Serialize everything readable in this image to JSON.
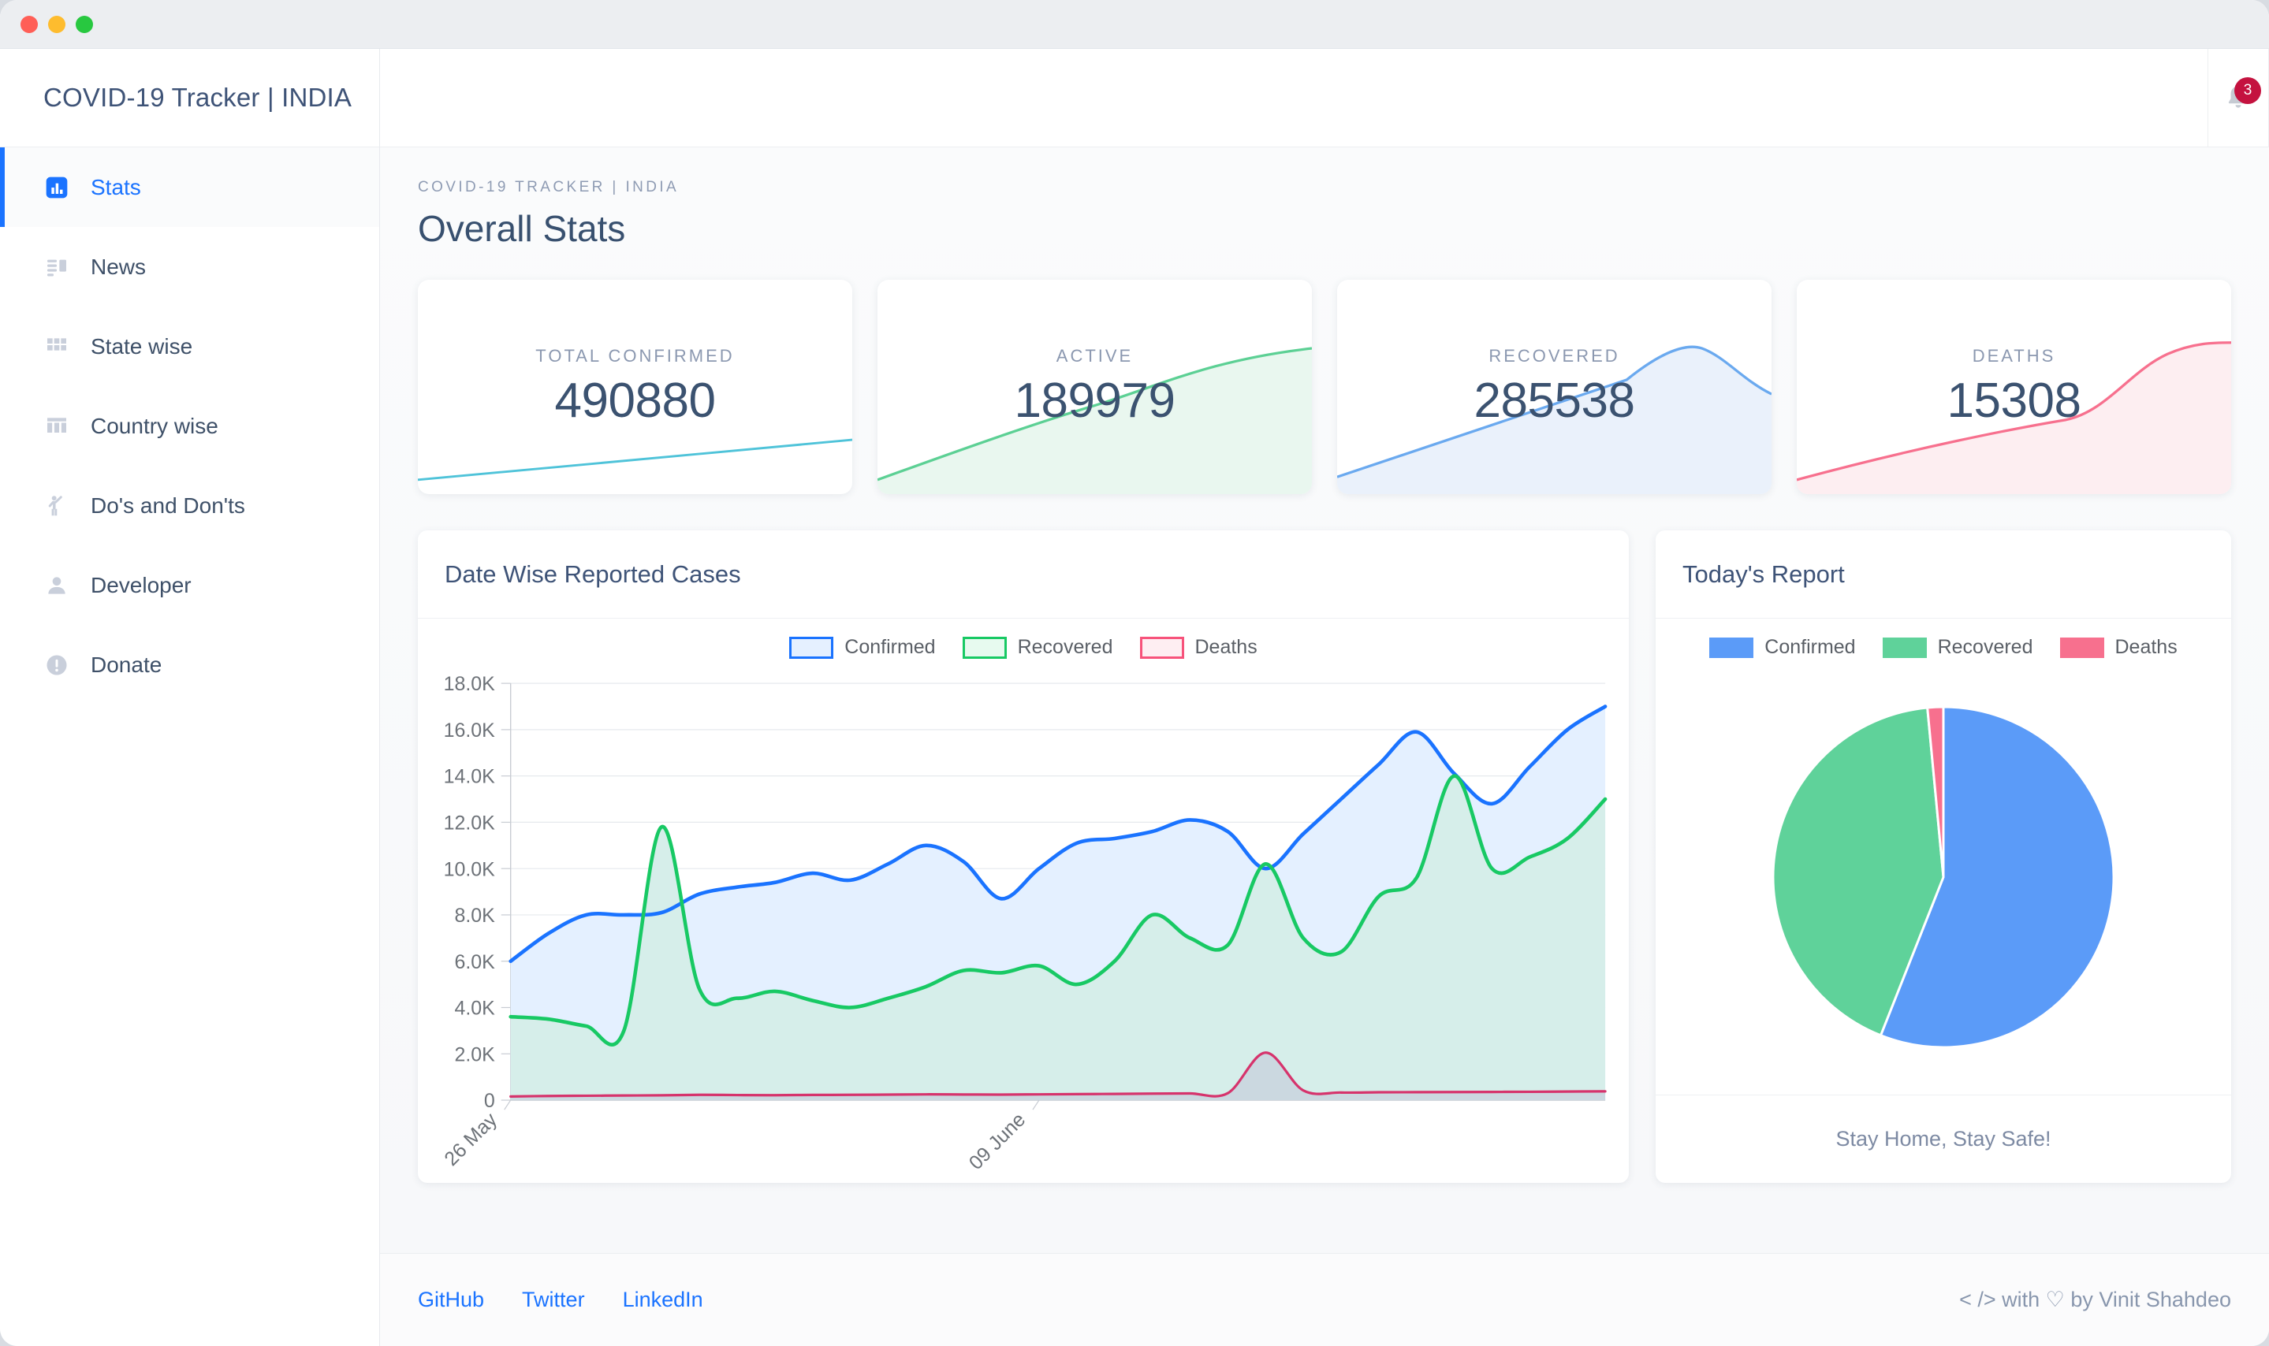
{
  "window": {
    "traffic_lights": [
      "close",
      "minimize",
      "zoom"
    ]
  },
  "sidebar": {
    "brand": "COVID-19 Tracker | INDIA",
    "items": [
      {
        "label": "Stats",
        "icon": "bar-chart-icon",
        "active": true
      },
      {
        "label": "News",
        "icon": "news-list-icon",
        "active": false
      },
      {
        "label": "State wise",
        "icon": "grid-icon",
        "active": false
      },
      {
        "label": "Country wise",
        "icon": "table-columns-icon",
        "active": false
      },
      {
        "label": "Do's and Don'ts",
        "icon": "person-wave-icon",
        "active": false
      },
      {
        "label": "Developer",
        "icon": "user-icon",
        "active": false
      },
      {
        "label": "Donate",
        "icon": "info-circle-icon",
        "active": false
      }
    ]
  },
  "topbar": {
    "bell_icon": "bell-icon",
    "notification_count": "3"
  },
  "header": {
    "eyebrow": "COVID-19 TRACKER | INDIA",
    "title": "Overall Stats"
  },
  "stat_cards": [
    {
      "label": "TOTAL CONFIRMED",
      "value": "490880",
      "color": "#4fc3d9"
    },
    {
      "label": "ACTIVE",
      "value": "189979",
      "color": "#5cd094"
    },
    {
      "label": "RECOVERED",
      "value": "285538",
      "color": "#6aa9ef"
    },
    {
      "label": "DEATHS",
      "value": "15308",
      "color": "#f7708e"
    }
  ],
  "line_panel": {
    "title": "Date Wise Reported Cases"
  },
  "pie_panel": {
    "title": "Today's Report",
    "footer_note": "Stay Home, Stay Safe!"
  },
  "footer": {
    "links": [
      "GitHub",
      "Twitter",
      "LinkedIn"
    ],
    "credit": "< /> with ♡ by Vinit Shahdeo"
  },
  "chart_data": [
    {
      "id": "date-wise-reported-cases",
      "type": "area",
      "title": "Date Wise Reported Cases",
      "xlabel": "",
      "ylabel": "",
      "ylim": [
        0,
        18000
      ],
      "ytick_labels": [
        "0",
        "2.0K",
        "4.0K",
        "6.0K",
        "8.0K",
        "10.0K",
        "12.0K",
        "14.0K",
        "16.0K",
        "18.0K"
      ],
      "yticks": [
        0,
        2000,
        4000,
        6000,
        8000,
        10000,
        12000,
        14000,
        16000,
        18000
      ],
      "grid": true,
      "legend_position": "top-center",
      "xtick_labels": [
        "26 May",
        "09 June"
      ],
      "xtick_indices": [
        0,
        14
      ],
      "x": [
        "26 May",
        "27 May",
        "28 May",
        "29 May",
        "30 May",
        "31 May",
        "01 June",
        "02 June",
        "03 June",
        "04 June",
        "05 June",
        "06 June",
        "07 June",
        "08 June",
        "09 June",
        "10 June",
        "11 June",
        "12 June",
        "13 June",
        "14 June",
        "15 June",
        "16 June",
        "17 June",
        "18 June",
        "19 June",
        "20 June",
        "21 June",
        "22 June",
        "23 June",
        "24 June"
      ],
      "series": [
        {
          "name": "Confirmed",
          "color": "#1a73ff",
          "fill": "#e4f0ff",
          "values": [
            6000,
            7200,
            8000,
            8000,
            8100,
            8900,
            9200,
            9400,
            9800,
            9500,
            10200,
            11000,
            10300,
            8700,
            10000,
            11100,
            11300,
            11600,
            12100,
            11600,
            10000,
            11500,
            13000,
            14500,
            15900,
            14100,
            12800,
            14400,
            16000,
            17000
          ]
        },
        {
          "name": "Recovered",
          "color": "#18c964",
          "fill": "#d6eeea",
          "values": [
            3600,
            3500,
            3200,
            3000,
            11800,
            4800,
            4400,
            4700,
            4300,
            4000,
            4400,
            4900,
            5600,
            5500,
            5800,
            5000,
            6000,
            8000,
            7000,
            6700,
            10200,
            7000,
            6400,
            8800,
            9600,
            14000,
            10000,
            10500,
            11300,
            13000
          ]
        },
        {
          "name": "Deaths",
          "color": "#d6336c",
          "fill": "#c9d4de",
          "values": [
            160,
            180,
            190,
            200,
            210,
            230,
            220,
            215,
            225,
            230,
            240,
            250,
            245,
            240,
            250,
            260,
            270,
            280,
            290,
            300,
            2050,
            420,
            330,
            340,
            345,
            350,
            355,
            360,
            370,
            380
          ]
        }
      ]
    },
    {
      "id": "todays-report",
      "type": "pie",
      "title": "Today's Report",
      "legend_position": "top-center",
      "labels": [
        "Confirmed",
        "Recovered",
        "Deaths"
      ],
      "values": [
        56.0,
        42.5,
        1.5
      ],
      "colors": [
        "#5b9bf8",
        "#5fd29a",
        "#f7708e"
      ]
    }
  ]
}
